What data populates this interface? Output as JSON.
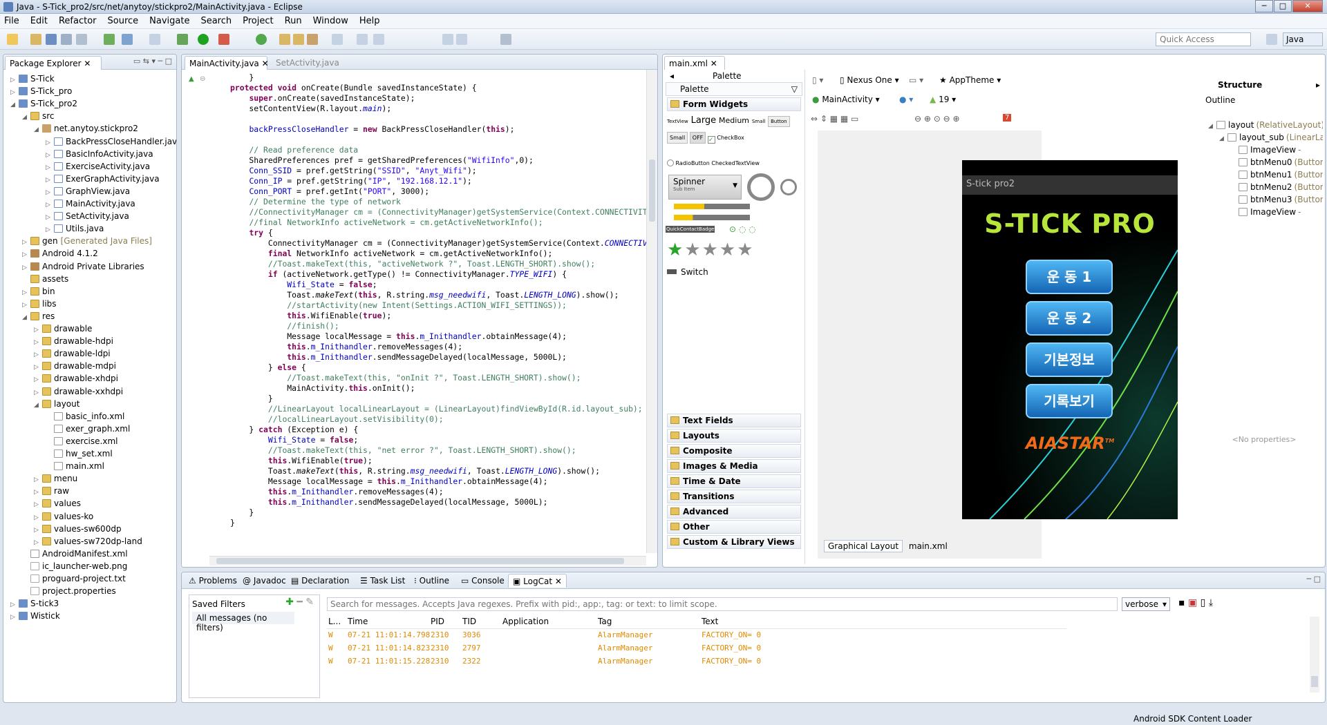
{
  "window": {
    "title": "Java - S-Tick_pro2/src/net/anytoy/stickpro2/MainActivity.java - Eclipse",
    "min": "─",
    "max": "□",
    "close": "✕"
  },
  "menu": [
    "File",
    "Edit",
    "Refactor",
    "Source",
    "Navigate",
    "Search",
    "Project",
    "Run",
    "Window",
    "Help"
  ],
  "toolbar": {
    "quick_access": "Quick Access",
    "perspective": "Java"
  },
  "package_explorer": {
    "tab": "Package Explorer",
    "nodes": [
      {
        "label": "S-Tick",
        "icon": "proj",
        "indent": 0,
        "arrow": "▷"
      },
      {
        "label": "S-Tick_pro",
        "icon": "proj",
        "indent": 0,
        "arrow": "▷"
      },
      {
        "label": "S-Tick_pro2",
        "icon": "proj",
        "indent": 0,
        "arrow": "◢"
      },
      {
        "label": "src",
        "icon": "folder",
        "indent": 1,
        "arrow": "◢"
      },
      {
        "label": "net.anytoy.stickpro2",
        "icon": "pkg",
        "indent": 2,
        "arrow": "◢"
      },
      {
        "label": "BackPressCloseHandler.java",
        "icon": "java",
        "indent": 3,
        "arrow": "▷"
      },
      {
        "label": "BasicInfoActivity.java",
        "icon": "java",
        "indent": 3,
        "arrow": "▷"
      },
      {
        "label": "ExerciseActivity.java",
        "icon": "java",
        "indent": 3,
        "arrow": "▷"
      },
      {
        "label": "ExerGraphActivity.java",
        "icon": "java",
        "indent": 3,
        "arrow": "▷"
      },
      {
        "label": "GraphView.java",
        "icon": "java",
        "indent": 3,
        "arrow": "▷"
      },
      {
        "label": "MainActivity.java",
        "icon": "java",
        "indent": 3,
        "arrow": "▷"
      },
      {
        "label": "SetActivity.java",
        "icon": "java",
        "indent": 3,
        "arrow": "▷"
      },
      {
        "label": "Utils.java",
        "icon": "java",
        "indent": 3,
        "arrow": "▷"
      },
      {
        "label": "gen",
        "extra": "[Generated Java Files]",
        "icon": "folder",
        "indent": 1,
        "arrow": "▷"
      },
      {
        "label": "Android 4.1.2",
        "icon": "lib",
        "indent": 1,
        "arrow": "▷"
      },
      {
        "label": "Android Private Libraries",
        "icon": "lib",
        "indent": 1,
        "arrow": "▷"
      },
      {
        "label": "assets",
        "icon": "folder",
        "indent": 1,
        "arrow": ""
      },
      {
        "label": "bin",
        "icon": "folder",
        "indent": 1,
        "arrow": "▷"
      },
      {
        "label": "libs",
        "icon": "folder",
        "indent": 1,
        "arrow": "▷"
      },
      {
        "label": "res",
        "icon": "folder",
        "indent": 1,
        "arrow": "◢"
      },
      {
        "label": "drawable",
        "icon": "folder",
        "indent": 2,
        "arrow": "▷"
      },
      {
        "label": "drawable-hdpi",
        "icon": "folder",
        "indent": 2,
        "arrow": "▷"
      },
      {
        "label": "drawable-ldpi",
        "icon": "folder",
        "indent": 2,
        "arrow": "▷"
      },
      {
        "label": "drawable-mdpi",
        "icon": "folder",
        "indent": 2,
        "arrow": "▷"
      },
      {
        "label": "drawable-xhdpi",
        "icon": "folder",
        "indent": 2,
        "arrow": "▷"
      },
      {
        "label": "drawable-xxhdpi",
        "icon": "folder",
        "indent": 2,
        "arrow": "▷"
      },
      {
        "label": "layout",
        "icon": "folder",
        "indent": 2,
        "arrow": "◢"
      },
      {
        "label": "basic_info.xml",
        "icon": "xml",
        "indent": 3,
        "arrow": ""
      },
      {
        "label": "exer_graph.xml",
        "icon": "xml",
        "indent": 3,
        "arrow": ""
      },
      {
        "label": "exercise.xml",
        "icon": "xml",
        "indent": 3,
        "arrow": ""
      },
      {
        "label": "hw_set.xml",
        "icon": "xml",
        "indent": 3,
        "arrow": ""
      },
      {
        "label": "main.xml",
        "icon": "xml",
        "indent": 3,
        "arrow": ""
      },
      {
        "label": "menu",
        "icon": "folder",
        "indent": 2,
        "arrow": "▷"
      },
      {
        "label": "raw",
        "icon": "folder",
        "indent": 2,
        "arrow": "▷"
      },
      {
        "label": "values",
        "icon": "folder",
        "indent": 2,
        "arrow": "▷"
      },
      {
        "label": "values-ko",
        "icon": "folder",
        "indent": 2,
        "arrow": "▷"
      },
      {
        "label": "values-sw600dp",
        "icon": "folder",
        "indent": 2,
        "arrow": "▷"
      },
      {
        "label": "values-sw720dp-land",
        "icon": "folder",
        "indent": 2,
        "arrow": "▷"
      },
      {
        "label": "AndroidManifest.xml",
        "icon": "xml",
        "indent": 1,
        "arrow": ""
      },
      {
        "label": "ic_launcher-web.png",
        "icon": "file",
        "indent": 1,
        "arrow": ""
      },
      {
        "label": "proguard-project.txt",
        "icon": "file",
        "indent": 1,
        "arrow": ""
      },
      {
        "label": "project.properties",
        "icon": "file",
        "indent": 1,
        "arrow": ""
      },
      {
        "label": "S-tick3",
        "icon": "proj",
        "indent": 0,
        "arrow": "▷"
      },
      {
        "label": "Wistick",
        "icon": "proj",
        "indent": 0,
        "arrow": "▷"
      }
    ]
  },
  "editor": {
    "tabs": [
      "MainActivity.java",
      "SetActivity.java"
    ]
  },
  "layout_editor": {
    "tab": "main.xml",
    "palette_title": "Palette",
    "palette_dropdown": "Palette",
    "form_widgets": "Form Widgets",
    "widget_labels": {
      "textview": "TextView",
      "large": "Large",
      "medium": "Medium",
      "small": "Small",
      "button": "Button",
      "small_btn": "Small",
      "off": "OFF",
      "checkbox": "CheckBox",
      "radio": "RadioButton",
      "checked_tv": "CheckedTextView",
      "spinner": "Spinner",
      "sub_item": "Sub Item",
      "qcb": "QuickContactBadge",
      "switch": "Switch"
    },
    "categories": [
      "Text Fields",
      "Layouts",
      "Composite",
      "Images & Media",
      "Time & Date",
      "Transitions",
      "Advanced",
      "Other",
      "Custom & Library Views"
    ],
    "device": "Nexus One",
    "theme": "AppTheme",
    "activity": "MainActivity",
    "api": "19",
    "error_count": "7",
    "app_title": "S-tick pro2",
    "logo": "S-TICK PRO",
    "buttons": [
      "운 동 1",
      "운 동 2",
      "기본정보",
      "기록보기"
    ],
    "brand": "AIASTAR",
    "brand_tm": "TM",
    "bottom_tabs": [
      "Graphical Layout",
      "main.xml"
    ]
  },
  "structure": {
    "title": "Structure",
    "outline": "Outline",
    "nodes": [
      {
        "label": "layout",
        "extra": "(RelativeLayout)",
        "indent": 0
      },
      {
        "label": "layout_sub",
        "extra": "(LinearLayout)",
        "indent": 1
      },
      {
        "label": "ImageView",
        "extra": "- ",
        "indent": 2
      },
      {
        "label": "btnMenu0",
        "extra": "(Button)",
        "indent": 2
      },
      {
        "label": "btnMenu1",
        "extra": "(Button)",
        "indent": 2
      },
      {
        "label": "btnMenu2",
        "extra": "(Button)",
        "indent": 2
      },
      {
        "label": "btnMenu3",
        "extra": "(Button)",
        "indent": 2
      },
      {
        "label": "ImageView",
        "extra": "- ",
        "indent": 2
      }
    ],
    "no_props": "<No properties>"
  },
  "bottom": {
    "tabs": [
      "Problems",
      "Javadoc",
      "Declaration",
      "Task List",
      "Outline",
      "Console",
      "LogCat"
    ],
    "saved_filters": "Saved Filters",
    "all_messages": "All messages (no filters)",
    "search_placeholder": "Search for messages. Accepts Java regexes. Prefix with pid:, app:, tag: or text: to limit scope.",
    "level": "verbose",
    "columns": [
      "L...",
      "Time",
      "PID",
      "TID",
      "Application",
      "Tag",
      "Text"
    ],
    "rows": [
      {
        "level": "W",
        "time": "07-21 11:01:14.798",
        "pid": "2310",
        "tid": "3036",
        "app": "",
        "tag": "AlarmManager",
        "text": "FACTORY_ON= 0"
      },
      {
        "level": "W",
        "time": "07-21 11:01:14.823",
        "pid": "2310",
        "tid": "2797",
        "app": "",
        "tag": "AlarmManager",
        "text": "FACTORY_ON= 0"
      },
      {
        "level": "W",
        "time": "07-21 11:01:15.228",
        "pid": "2310",
        "tid": "2322",
        "app": "",
        "tag": "AlarmManager",
        "text": "FACTORY_ON= 0"
      }
    ]
  },
  "status": {
    "text": "Android SDK Content Loader"
  }
}
